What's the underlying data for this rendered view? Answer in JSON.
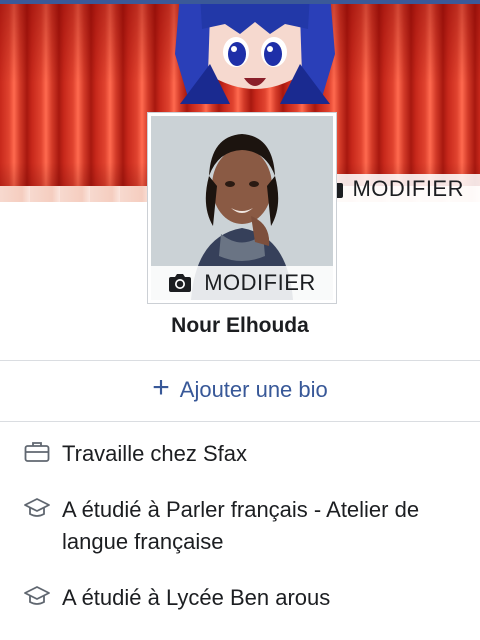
{
  "cover": {
    "edit_label": "MODIFIER",
    "camera_icon": "camera-icon"
  },
  "profile": {
    "edit_label": "MODIFIER",
    "name": "Nour Elhouda"
  },
  "bio": {
    "add_label": "Ajouter une bio"
  },
  "details": [
    {
      "icon": "briefcase-icon",
      "text": "Travaille chez Sfax"
    },
    {
      "icon": "graduation-cap-icon",
      "text": "A étudié à Parler français - Atelier de langue française"
    },
    {
      "icon": "graduation-cap-icon",
      "text": "A étudié à Lycée Ben arous"
    }
  ],
  "colors": {
    "accent": "#385898",
    "topbar": "#3b5998",
    "divider": "#dadde1"
  }
}
